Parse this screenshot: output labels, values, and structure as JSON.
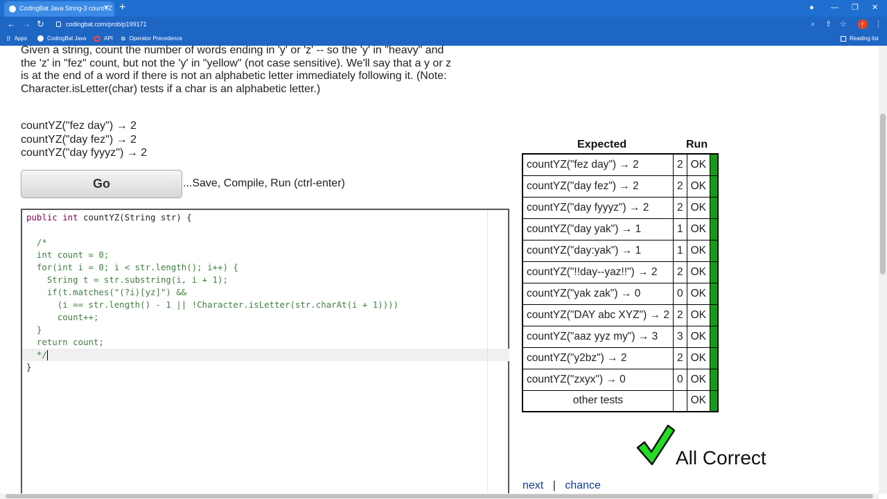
{
  "browser": {
    "tab_title": "CodingBat Java String-3 countYZ",
    "url": "codingbat.com/prob/p199171",
    "profile_initial": "r",
    "bookmarks": [
      "Apps",
      "CodingBat Java",
      "API",
      "Operator Precedence"
    ],
    "reading_list": "Reading list"
  },
  "problem": {
    "description_lines": [
      "Given a string, count the number of words ending in 'y' or 'z' -- so the 'y' in \"heavy\" and",
      "the 'z' in \"fez\" count, but not the 'y' in \"yellow\" (not case sensitive). We'll say that a y or z",
      "is at the end of a word if there is not an alphabetic letter immediately following it. (Note:",
      "Character.isLetter(char) tests if a char is an alphabetic letter.)"
    ],
    "examples": [
      "countYZ(\"fez day\") → 2",
      "countYZ(\"day fez\") → 2",
      "countYZ(\"day fyyyz\") → 2"
    ],
    "go_label": "Go",
    "go_hint": "...Save, Compile, Run (ctrl-enter)"
  },
  "editor": {
    "lines": [
      "public int countYZ(String str) {",
      "",
      "  /*",
      "  int count = 0;",
      "  for(int i = 0; i < str.length(); i++) {",
      "    String t = str.substring(i, i + 1);",
      "    if(t.matches(\"(?i)[yz]\") &&",
      "      (i == str.length() - 1 || !Character.isLetter(str.charAt(i + 1))))",
      "      count++;",
      "  }",
      "  return count;",
      "  */",
      "}"
    ]
  },
  "results": {
    "header_expected": "Expected",
    "header_run": "Run",
    "rows": [
      {
        "expected": "countYZ(\"fez day\") → 2",
        "run": "2",
        "status": "OK"
      },
      {
        "expected": "countYZ(\"day fez\") → 2",
        "run": "2",
        "status": "OK"
      },
      {
        "expected": "countYZ(\"day fyyyz\") → 2",
        "run": "2",
        "status": "OK"
      },
      {
        "expected": "countYZ(\"day yak\") → 1",
        "run": "1",
        "status": "OK"
      },
      {
        "expected": "countYZ(\"day:yak\") → 1",
        "run": "1",
        "status": "OK"
      },
      {
        "expected": "countYZ(\"!!day--yaz!!\") → 2",
        "run": "2",
        "status": "OK"
      },
      {
        "expected": "countYZ(\"yak zak\") → 0",
        "run": "0",
        "status": "OK"
      },
      {
        "expected": "countYZ(\"DAY abc XYZ\") → 2",
        "run": "2",
        "status": "OK"
      },
      {
        "expected": "countYZ(\"aaz yyz my\") → 3",
        "run": "3",
        "status": "OK"
      },
      {
        "expected": "countYZ(\"y2bz\") → 2",
        "run": "2",
        "status": "OK"
      },
      {
        "expected": "countYZ(\"zxyx\") → 0",
        "run": "0",
        "status": "OK"
      }
    ],
    "other_label": "other tests",
    "other_status": "OK",
    "pass_color": "#199a19",
    "all_correct": "All Correct",
    "next_label": "next",
    "separator": "|",
    "chance_label": "chance"
  }
}
